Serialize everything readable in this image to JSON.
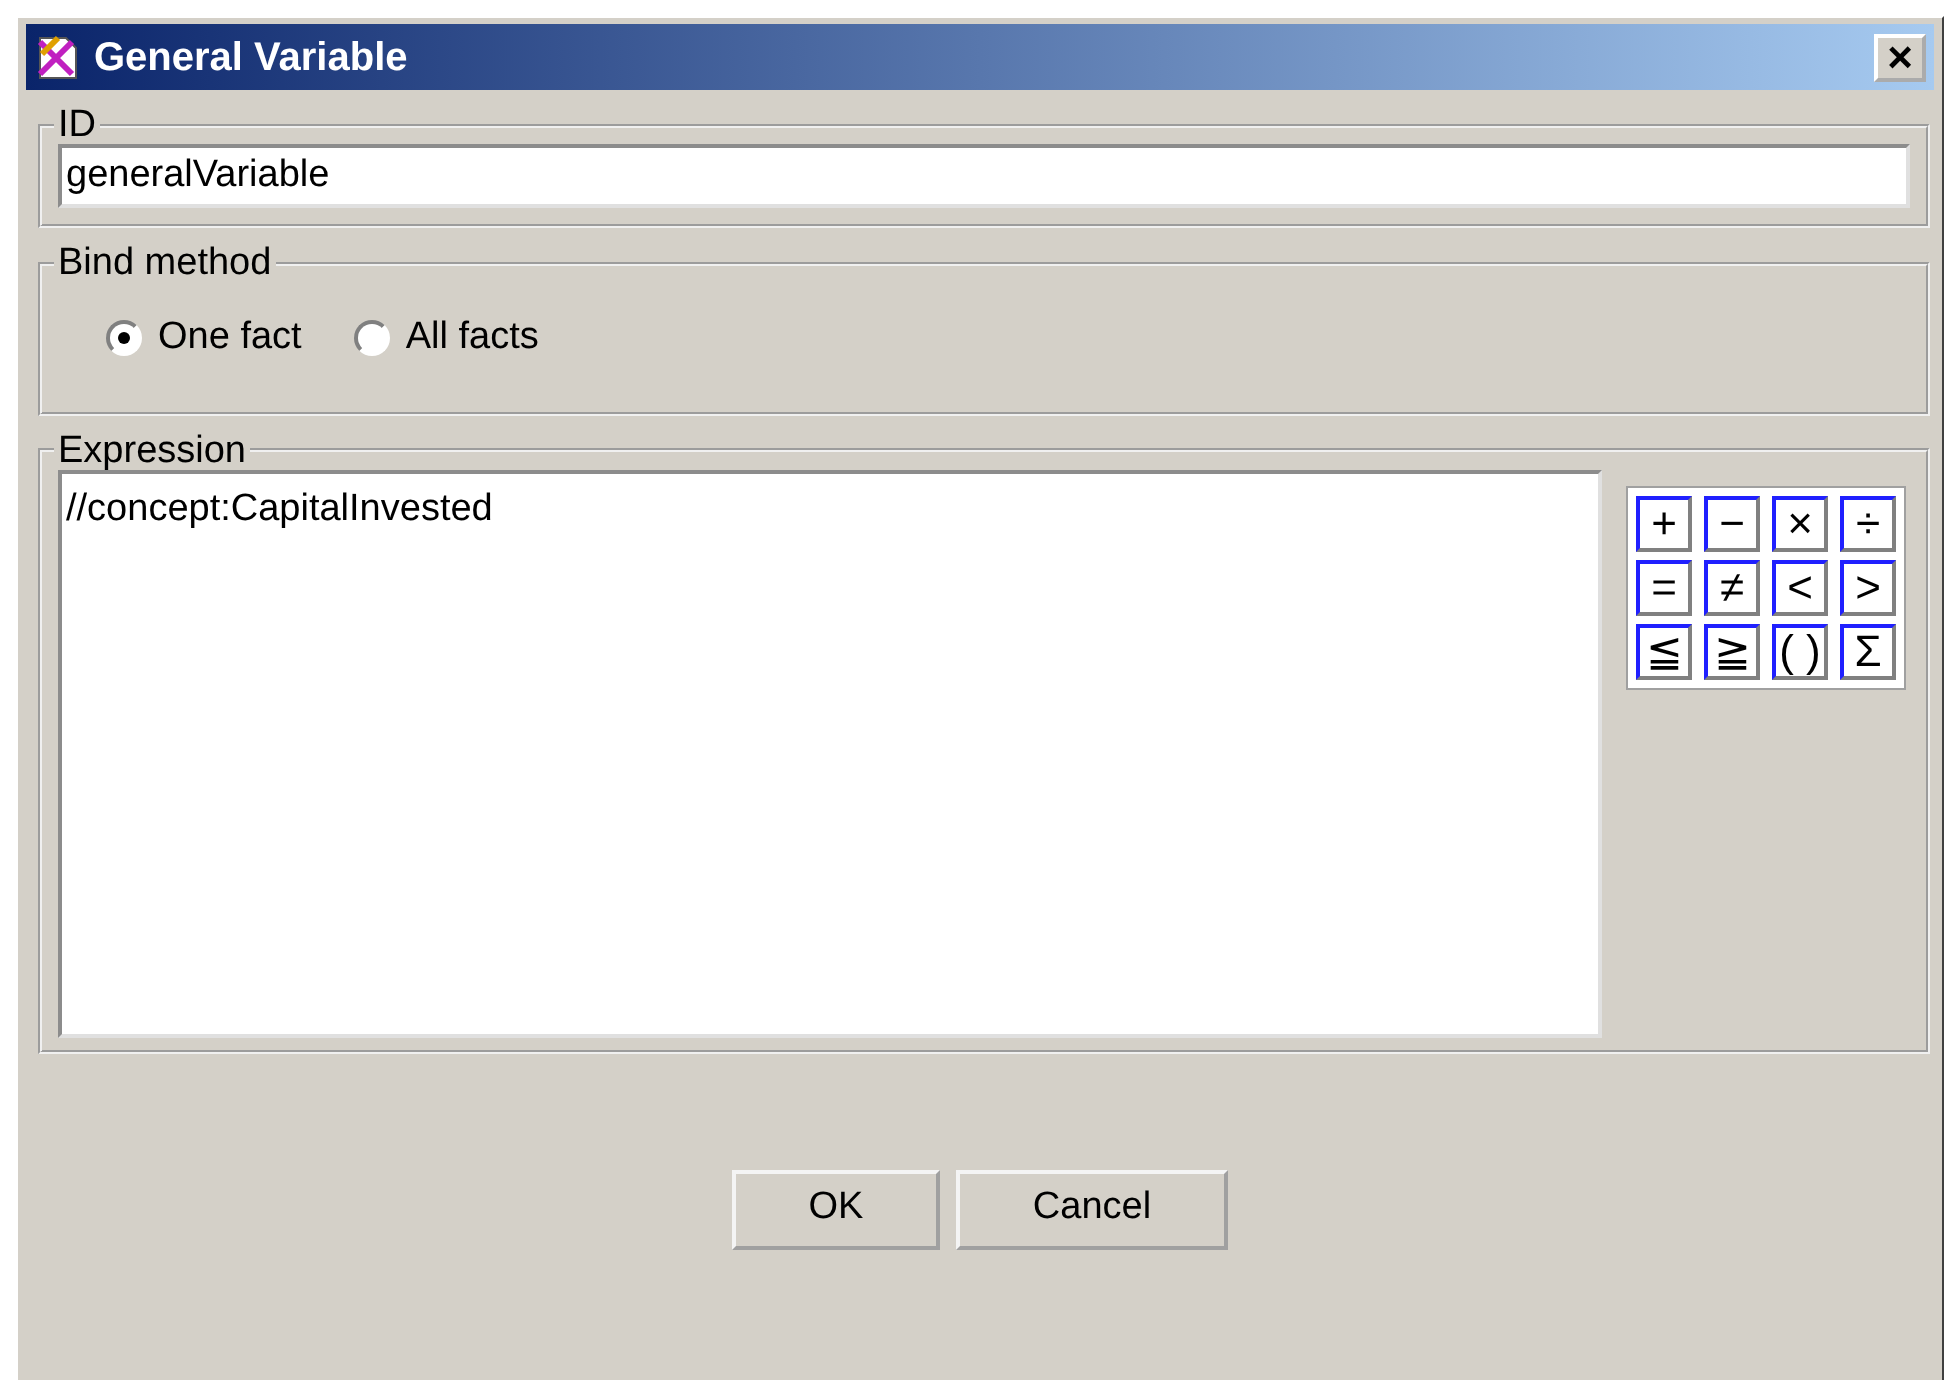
{
  "window": {
    "title": "General Variable",
    "close": "×"
  },
  "id_group": {
    "label": "ID",
    "value": "generalVariable"
  },
  "bind_method": {
    "label": "Bind method",
    "options": [
      {
        "label": "One fact",
        "selected": true
      },
      {
        "label": "All facts",
        "selected": false
      }
    ]
  },
  "expression": {
    "label": "Expression",
    "value": "//concept:CapitalInvested",
    "operators": [
      "+",
      "−",
      "×",
      "÷",
      "=",
      "≠",
      "<",
      ">",
      "≦",
      "≧",
      "( )",
      "Σ"
    ]
  },
  "buttons": [
    "OK",
    "Cancel"
  ]
}
